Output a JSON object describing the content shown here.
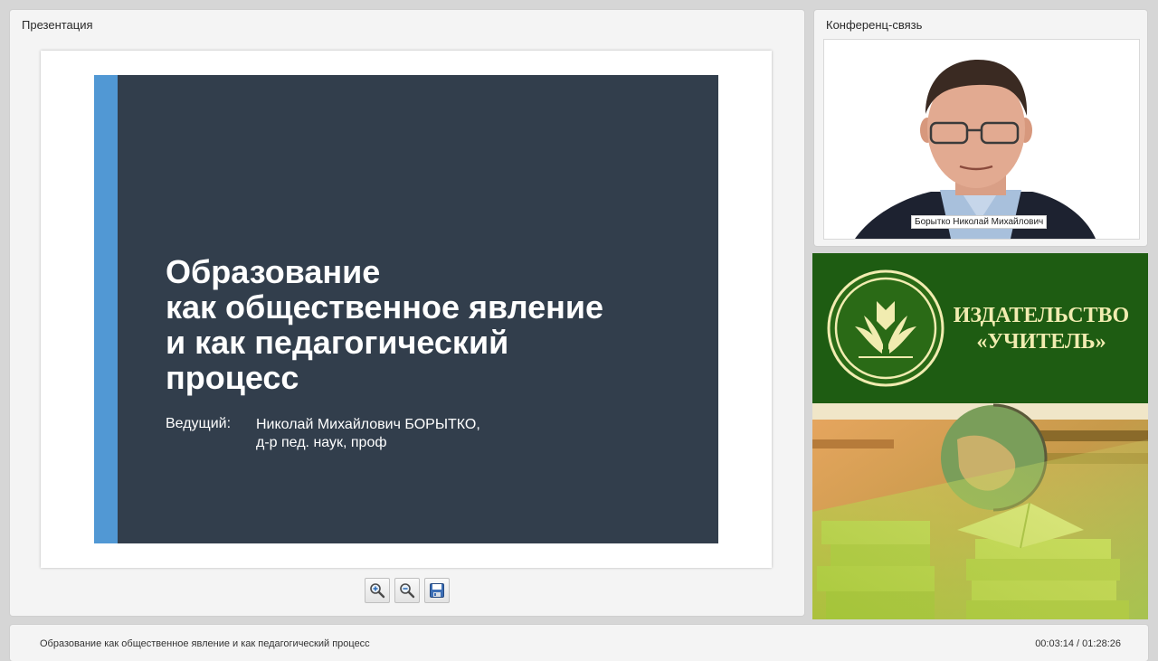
{
  "presentation_panel": {
    "title": "Презентация",
    "slide": {
      "title_lines": [
        "Образование",
        "как общественное явление",
        "и как педагогический",
        "процесс"
      ],
      "presenter_label": "Ведущий:",
      "presenter_name": "Николай Михайлович БОРЫТКО,",
      "presenter_credentials": "д-р пед. наук, проф"
    },
    "toolbar": {
      "zoom_in_icon": "zoom-in-icon",
      "zoom_out_icon": "zoom-out-icon",
      "save_icon": "save-icon"
    }
  },
  "conference_panel": {
    "title": "Конференц-связь",
    "participant_name": "Борытко Николай Михайлович"
  },
  "publisher_banner": {
    "line1": "ИЗДАТЕЛЬСТВО",
    "line2": "«УЧИТЕЛЬ»"
  },
  "footer": {
    "title": "Образование как общественное явление и как педагогический процесс",
    "time": "00:03:14 / 01:28:26"
  },
  "colors": {
    "slide_background": "#323e4c",
    "slide_accent": "#5198d4",
    "banner_green": "#1e5c12",
    "banner_text": "#f1ecb0"
  }
}
